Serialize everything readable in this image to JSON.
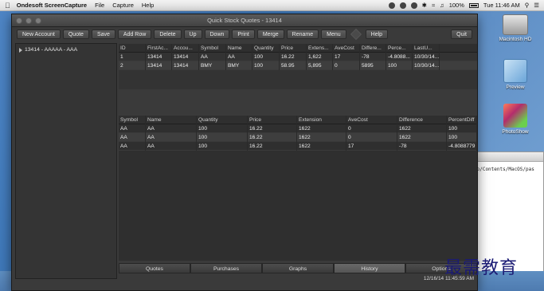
{
  "menubar": {
    "app_name": "Ondesoft ScreenCapture",
    "menus": [
      "File",
      "Capture",
      "Help"
    ],
    "battery": "100%",
    "clock": "Tue 11:46 AM"
  },
  "desktop": {
    "icons": [
      {
        "label": "Macintosh HD",
        "icon": "hard-drive-icon"
      },
      {
        "label": "Preview",
        "icon": "preview-icon"
      },
      {
        "label": "PhotoShow",
        "icon": "photoshow-icon"
      }
    ],
    "bg_window": {
      "text": "pp/Contents/MacOS/pas"
    }
  },
  "window": {
    "title": "Quick Stock Quotes - 13414",
    "toolbar": [
      "New Account",
      "Quote",
      "Save",
      "Add Row",
      "Delete",
      "Up",
      "Down",
      "Print",
      "Merge",
      "Rename",
      "Menu",
      "Help"
    ],
    "quit_label": "Quit",
    "sidebar": {
      "items": [
        "13414 - AAAAA - AAA"
      ]
    },
    "top_table": {
      "headers": [
        "ID",
        "FirstAc...",
        "Accou...",
        "Symbol",
        "Name",
        "Quantity",
        "Price",
        "Extens...",
        "AveCost",
        "Differe...",
        "Perce...",
        "LastU..."
      ],
      "rows": [
        [
          "1",
          "13414",
          "13414",
          "AA",
          "AA",
          "100",
          "16.22",
          "1,622",
          "17",
          "-78",
          "-4.8088...",
          "10/30/14..."
        ],
        [
          "2",
          "13414",
          "13414",
          "BMY",
          "BMY",
          "100",
          "58.95",
          "5,895",
          "0",
          "5895",
          "100",
          "10/30/14..."
        ]
      ]
    },
    "bottom_table": {
      "headers": [
        "Symbol",
        "Name",
        "Quantity",
        "Price",
        "Extension",
        "AveCost",
        "Difference",
        "PercentDiff"
      ],
      "rows": [
        [
          "AA",
          "AA",
          "100",
          "16.22",
          "1622",
          "0",
          "1622",
          "100"
        ],
        [
          "AA",
          "AA",
          "100",
          "16.22",
          "1622",
          "0",
          "1622",
          "100"
        ],
        [
          "AA",
          "AA",
          "100",
          "16.22",
          "1622",
          "17",
          "-78",
          "-4.8088779"
        ]
      ]
    },
    "tabs": [
      "Quotes",
      "Purchases",
      "Graphs",
      "History",
      "Options"
    ],
    "active_tab": "History",
    "status_time": "12/16/14 11:45:59 AM"
  },
  "watermark": "最需教育"
}
